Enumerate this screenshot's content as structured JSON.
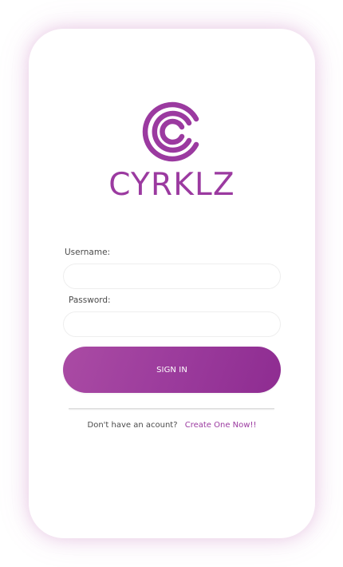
{
  "app": {
    "brand_name": "CYRKLZ",
    "logo_icon": "concentric-c-rings-logo-icon",
    "accent_color": "#9b3aa0",
    "button_gradient": [
      "#aa4ba4",
      "#8e2c91"
    ]
  },
  "login_form": {
    "username_label": "Username:",
    "username_value": "",
    "username_placeholder": "",
    "password_label": "Password:",
    "password_value": "",
    "password_placeholder": "",
    "sign_in_label": "SIGN IN"
  },
  "signup": {
    "prompt": "Don't have an acount?",
    "link_label": "Create One Now!!"
  }
}
